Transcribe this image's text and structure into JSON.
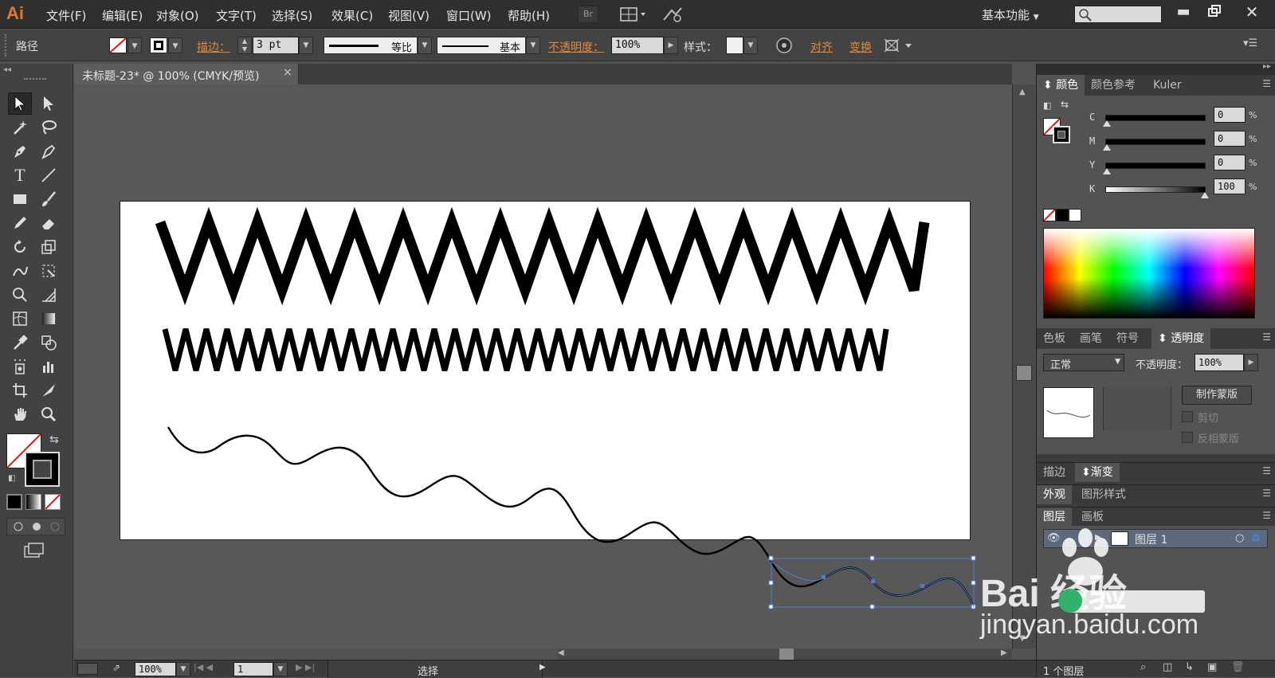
{
  "app": {
    "logo": "Ai",
    "workspace": "基本功能"
  },
  "menu": [
    "文件(F)",
    "编辑(E)",
    "对象(O)",
    "文字(T)",
    "选择(S)",
    "效果(C)",
    "视图(V)",
    "窗口(W)",
    "帮助(H)"
  ],
  "menubar_buttons": {
    "bridge": "Br"
  },
  "control": {
    "object_type": "路径",
    "stroke_label": "描边：",
    "stroke_weight": "3 pt",
    "profile1": "等比",
    "profile2": "基本",
    "opacity_label": "不透明度：",
    "opacity_value": "100%",
    "style_label": "样式：",
    "align": "对齐",
    "transform": "变换"
  },
  "document": {
    "tab_title": "未标题-23* @ 100% (CMYK/预览)",
    "close_glyph": "×"
  },
  "status": {
    "zoom": "100%",
    "artboard": "1",
    "tool": "选择",
    "layers_count": "1 个图层"
  },
  "color_panel": {
    "tabs": [
      "颜色",
      "颜色参考",
      "Kuler"
    ],
    "channels": [
      {
        "name": "C",
        "value": "0"
      },
      {
        "name": "M",
        "value": "0"
      },
      {
        "name": "Y",
        "value": "0"
      },
      {
        "name": "K",
        "value": "100"
      }
    ],
    "percent": "%"
  },
  "transparency_panel": {
    "tabs": [
      "色板",
      "画笔",
      "符号",
      "透明度"
    ],
    "blend_mode": "正常",
    "opacity_label": "不透明度：",
    "opacity_value": "100%",
    "make_mask": "制作蒙版",
    "clip": "剪切",
    "invert_mask": "反相蒙版"
  },
  "stroke_panel": {
    "tabs": [
      "描边",
      "渐变"
    ]
  },
  "appearance_panel": {
    "tabs": [
      "外观",
      "图形样式"
    ]
  },
  "layers_panel": {
    "tabs": [
      "图层",
      "画板"
    ],
    "layer_name": "图层 1"
  },
  "watermark": {
    "brand": "Bai  经验",
    "url": "jingyan.baidu.com"
  },
  "colors": {
    "accent_orange": "#e0893a",
    "selection_blue": "#4f7bd8",
    "app_bg": "#535353"
  }
}
